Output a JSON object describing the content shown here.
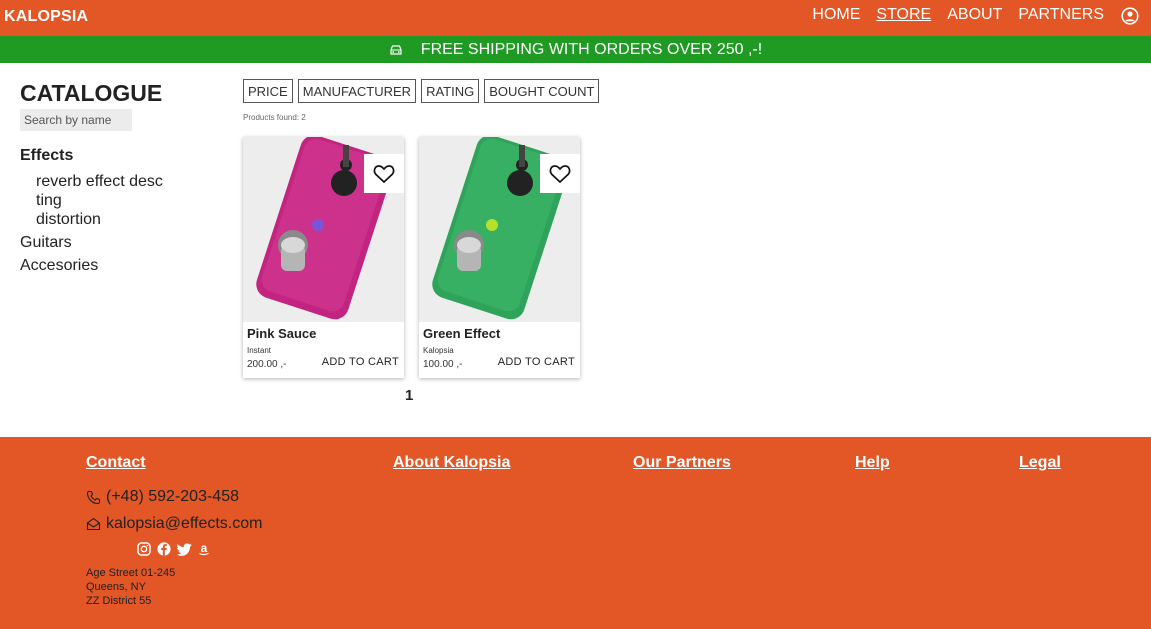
{
  "header": {
    "brand": "KALOPSIA",
    "nav": [
      {
        "label": "HOME"
      },
      {
        "label": "STORE",
        "active": true
      },
      {
        "label": "ABOUT"
      },
      {
        "label": "PARTNERS"
      }
    ],
    "user_icon": "user-circle-icon"
  },
  "banner": {
    "text": "FREE SHIPPING WITH ORDERS OVER 250 ,-!",
    "icon": "car-icon",
    "color": "#1f9a23"
  },
  "sidebar": {
    "title": "CATALOGUE",
    "search_placeholder": "Search by name",
    "group": "Effects",
    "subcategories": [
      "reverb effect desc ting",
      "distortion"
    ],
    "categories": [
      "Guitars",
      "Accesories"
    ]
  },
  "filters": [
    "PRICE",
    "MANUFACTURER",
    "RATING",
    "BOUGHT COUNT"
  ],
  "products_found": "Products found: 2",
  "products": [
    {
      "name": "Pink Sauce",
      "maker": "Instant",
      "price": "200.00 ,-",
      "cart": "ADD TO CART",
      "color": "#c2247f"
    },
    {
      "name": "Green Effect",
      "maker": "Kalopsia",
      "price": "100.00 ,-",
      "cart": "ADD TO CART",
      "color": "#2fa35a"
    }
  ],
  "pagination": {
    "current": "1"
  },
  "footer": {
    "links": [
      "Contact",
      "About Kalopsia",
      "Our Partners",
      "Help",
      "Legal"
    ],
    "phone": "(+48) 592-203-458",
    "email": "kalopsia@effects.com",
    "socials": [
      "instagram-icon",
      "facebook-icon",
      "twitter-icon",
      "amazon-icon"
    ],
    "address": [
      "Age Street 01-245",
      "Queens, NY",
      "ZZ District 55"
    ]
  },
  "colors": {
    "accent": "#e35625",
    "banner": "#1f9a23"
  }
}
